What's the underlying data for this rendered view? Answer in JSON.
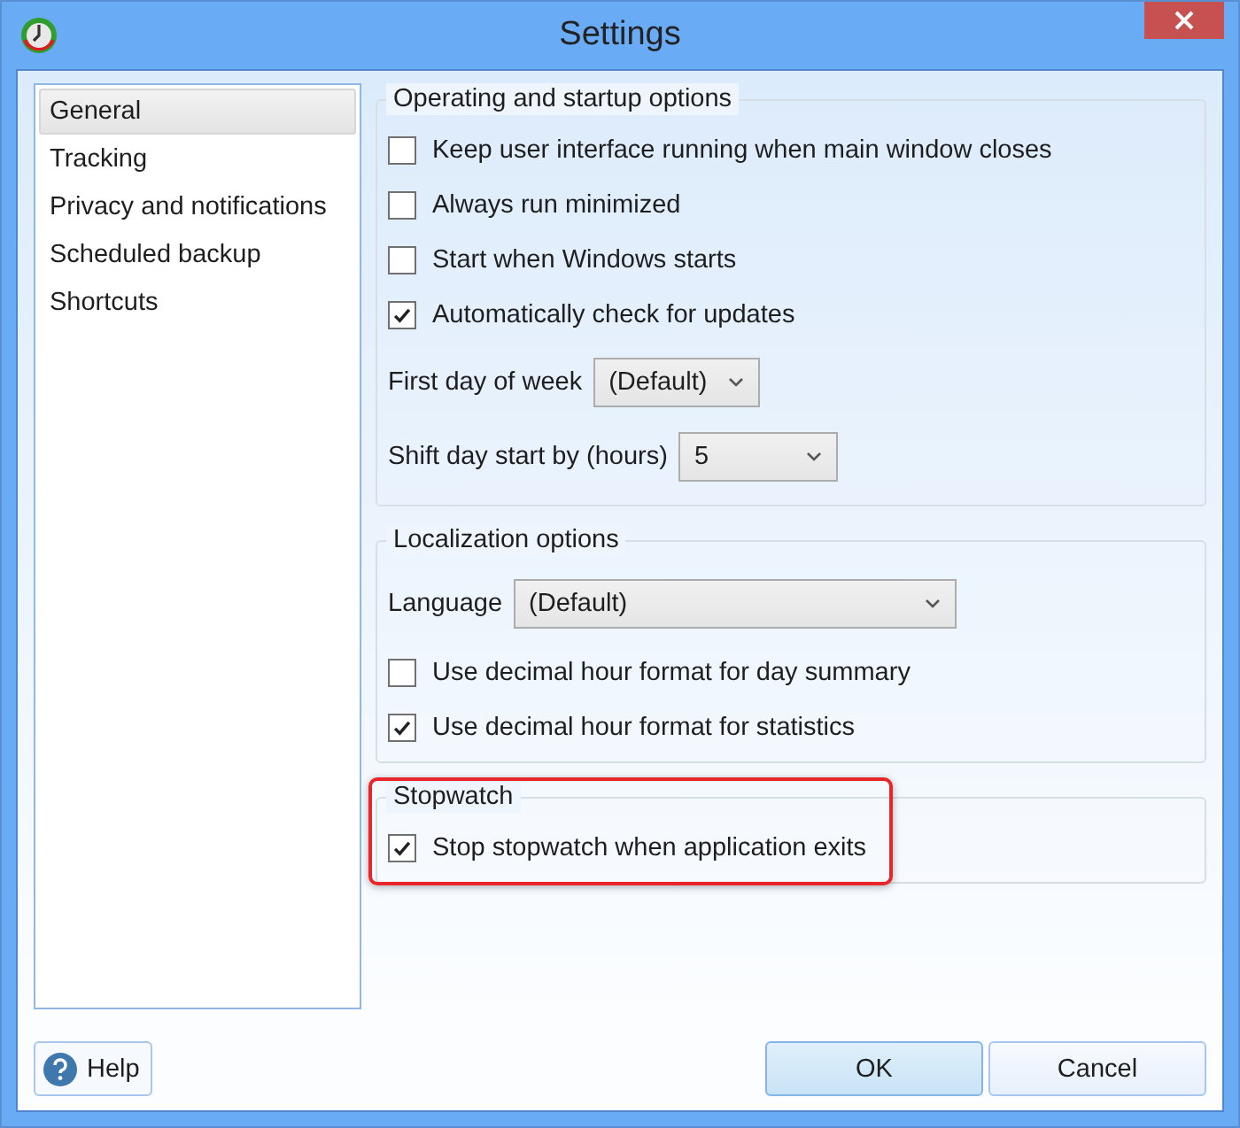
{
  "window": {
    "title": "Settings"
  },
  "sidebar": {
    "items": [
      {
        "label": "General",
        "selected": true
      },
      {
        "label": "Tracking",
        "selected": false
      },
      {
        "label": "Privacy and notifications",
        "selected": false
      },
      {
        "label": "Scheduled backup",
        "selected": false
      },
      {
        "label": "Shortcuts",
        "selected": false
      }
    ]
  },
  "groups": [
    {
      "title": "Operating and startup options",
      "highlighted": false,
      "items": [
        {
          "kind": "checkbox",
          "label": "Keep user interface running when main window closes",
          "checked": false
        },
        {
          "kind": "checkbox",
          "label": "Always run minimized",
          "checked": false
        },
        {
          "kind": "checkbox",
          "label": "Start when Windows starts",
          "checked": false
        },
        {
          "kind": "checkbox",
          "label": "Automatically check for updates",
          "checked": true
        },
        {
          "kind": "dropdown",
          "label": "First day of week",
          "value": "(Default)"
        },
        {
          "kind": "dropdown",
          "label": "Shift day start by (hours)",
          "value": "5"
        }
      ]
    },
    {
      "title": "Localization options",
      "highlighted": false,
      "items": [
        {
          "kind": "combobox",
          "label": "Language",
          "value": "(Default)"
        },
        {
          "kind": "checkbox",
          "label": "Use decimal hour format for day summary",
          "checked": false
        },
        {
          "kind": "checkbox",
          "label": "Use decimal hour format for statistics",
          "checked": true
        }
      ]
    },
    {
      "title": "Stopwatch",
      "highlighted": true,
      "items": [
        {
          "kind": "checkbox",
          "label": "Stop stopwatch when application exits",
          "checked": true
        }
      ]
    }
  ],
  "footer": {
    "help": "Help",
    "buttons": [
      {
        "label": "OK",
        "default": true
      },
      {
        "label": "Cancel",
        "default": false
      }
    ]
  }
}
